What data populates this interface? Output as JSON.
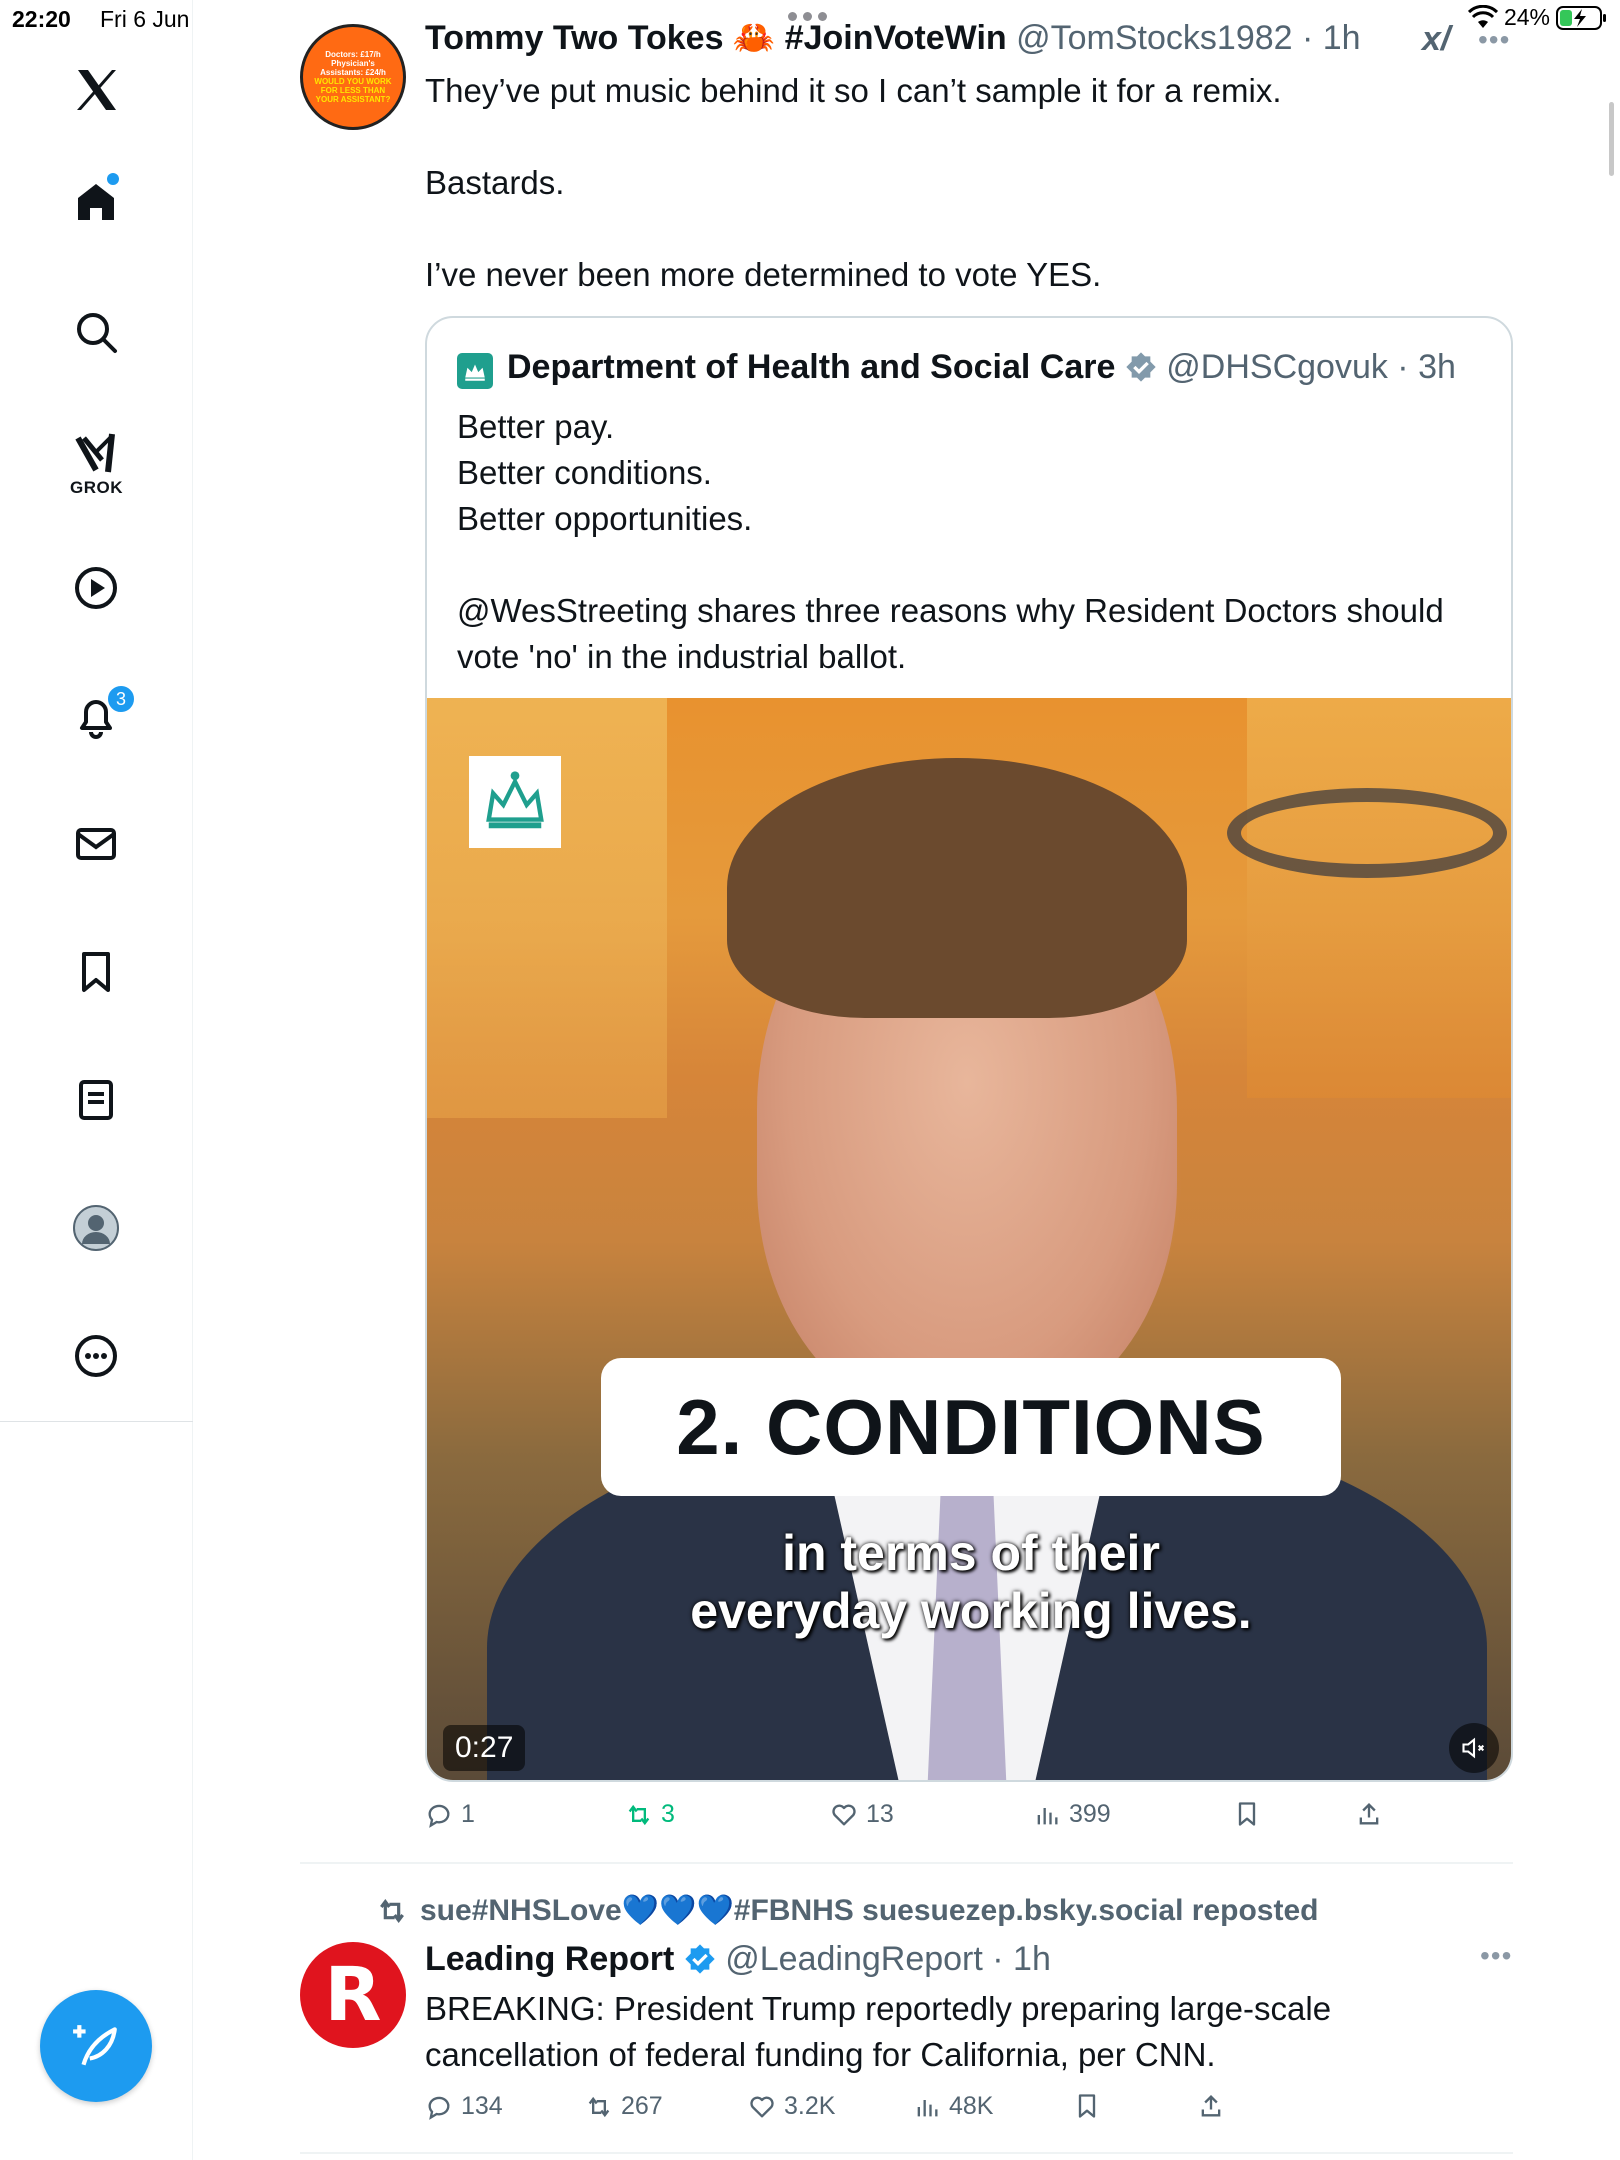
{
  "status_bar": {
    "time": "22:20",
    "date": "Fri 6 Jun",
    "battery": "24%"
  },
  "sidebar": {
    "items": [
      {
        "name": "x-logo"
      },
      {
        "name": "home",
        "has_dot": true
      },
      {
        "name": "search"
      },
      {
        "name": "grok",
        "label": "GROK"
      },
      {
        "name": "video"
      },
      {
        "name": "notifications",
        "badge": "3"
      },
      {
        "name": "messages"
      },
      {
        "name": "bookmarks"
      },
      {
        "name": "lists"
      },
      {
        "name": "profile"
      },
      {
        "name": "more"
      }
    ]
  },
  "tweet1": {
    "author_name": "Tommy Two Tokes 🦀 #JoinVoteWin",
    "handle_time": "@TomStocks1982 · 1h",
    "avatar_text": [
      "Doctors: £17/h",
      "Physician's",
      "Assistants: £24/h",
      "WOULD YOU WORK",
      "FOR LESS THAN",
      "YOUR ASSISTANT?"
    ],
    "text_lines": [
      "They’ve put music behind it so I can’t sample it for a remix.",
      "Bastards.",
      "I’ve never been more determined to vote YES."
    ],
    "quote": {
      "author_name": "Department of Health and Social Care",
      "handle_time": "@DHSCgovuk · 3h",
      "text_lines": [
        "Better pay.",
        "Better conditions.",
        "Better opportunities.",
        "@WesStreeting shares three reasons why Resident Doctors should",
        "vote 'no' in the industrial ballot."
      ],
      "media": {
        "caption_title": "2. CONDITIONS",
        "caption_sub_1": "in terms of their",
        "caption_sub_2": "everyday working lives.",
        "duration": "0:27"
      }
    },
    "actions": {
      "replies": "1",
      "reposts": "3",
      "likes": "13",
      "views": "399"
    }
  },
  "tweet2": {
    "repost_label": "sue#NHSLove💙💙💙#FBNHS suesuezep.bsky.social reposted",
    "author_name": "Leading Report",
    "handle_time": "@LeadingReport · 1h",
    "avatar_letter": "R",
    "text_lines": [
      "BREAKING: President Trump reportedly preparing large-scale",
      "cancellation of federal funding for California, per CNN."
    ],
    "actions": {
      "replies": "134",
      "reposts": "267",
      "likes": "3.2K",
      "views": "48K"
    }
  },
  "colors": {
    "accent": "#1d9bf0",
    "repost_green": "#00ba7c",
    "muted": "#536471",
    "verified": "#1d9bf0"
  }
}
